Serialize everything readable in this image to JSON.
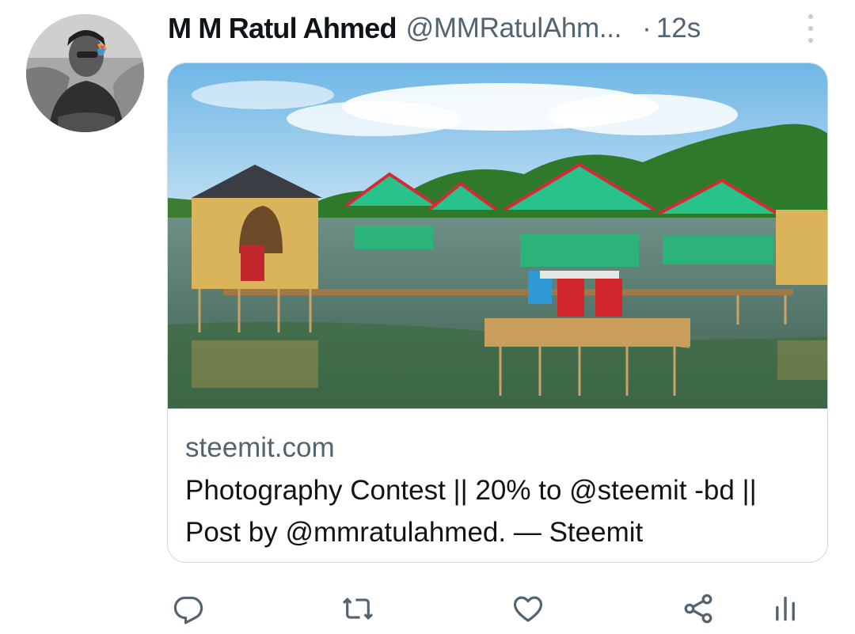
{
  "tweet": {
    "author_name": "M M Ratul Ahmed",
    "author_handle": "@MMRatulAhm...",
    "separator": "·",
    "time": "12s"
  },
  "link_card": {
    "domain": "steemit.com",
    "title": "Photography Contest || 20% to @steemit -bd || Post by @mmratulahmed. — Steemit"
  },
  "actions": {
    "reply": "reply-icon",
    "retweet": "retweet-icon",
    "like": "heart-icon",
    "share": "share-icon",
    "analytics": "analytics-icon"
  },
  "colors": {
    "text_primary": "#0f1419",
    "text_secondary": "#536471",
    "border": "#cfd9de"
  }
}
